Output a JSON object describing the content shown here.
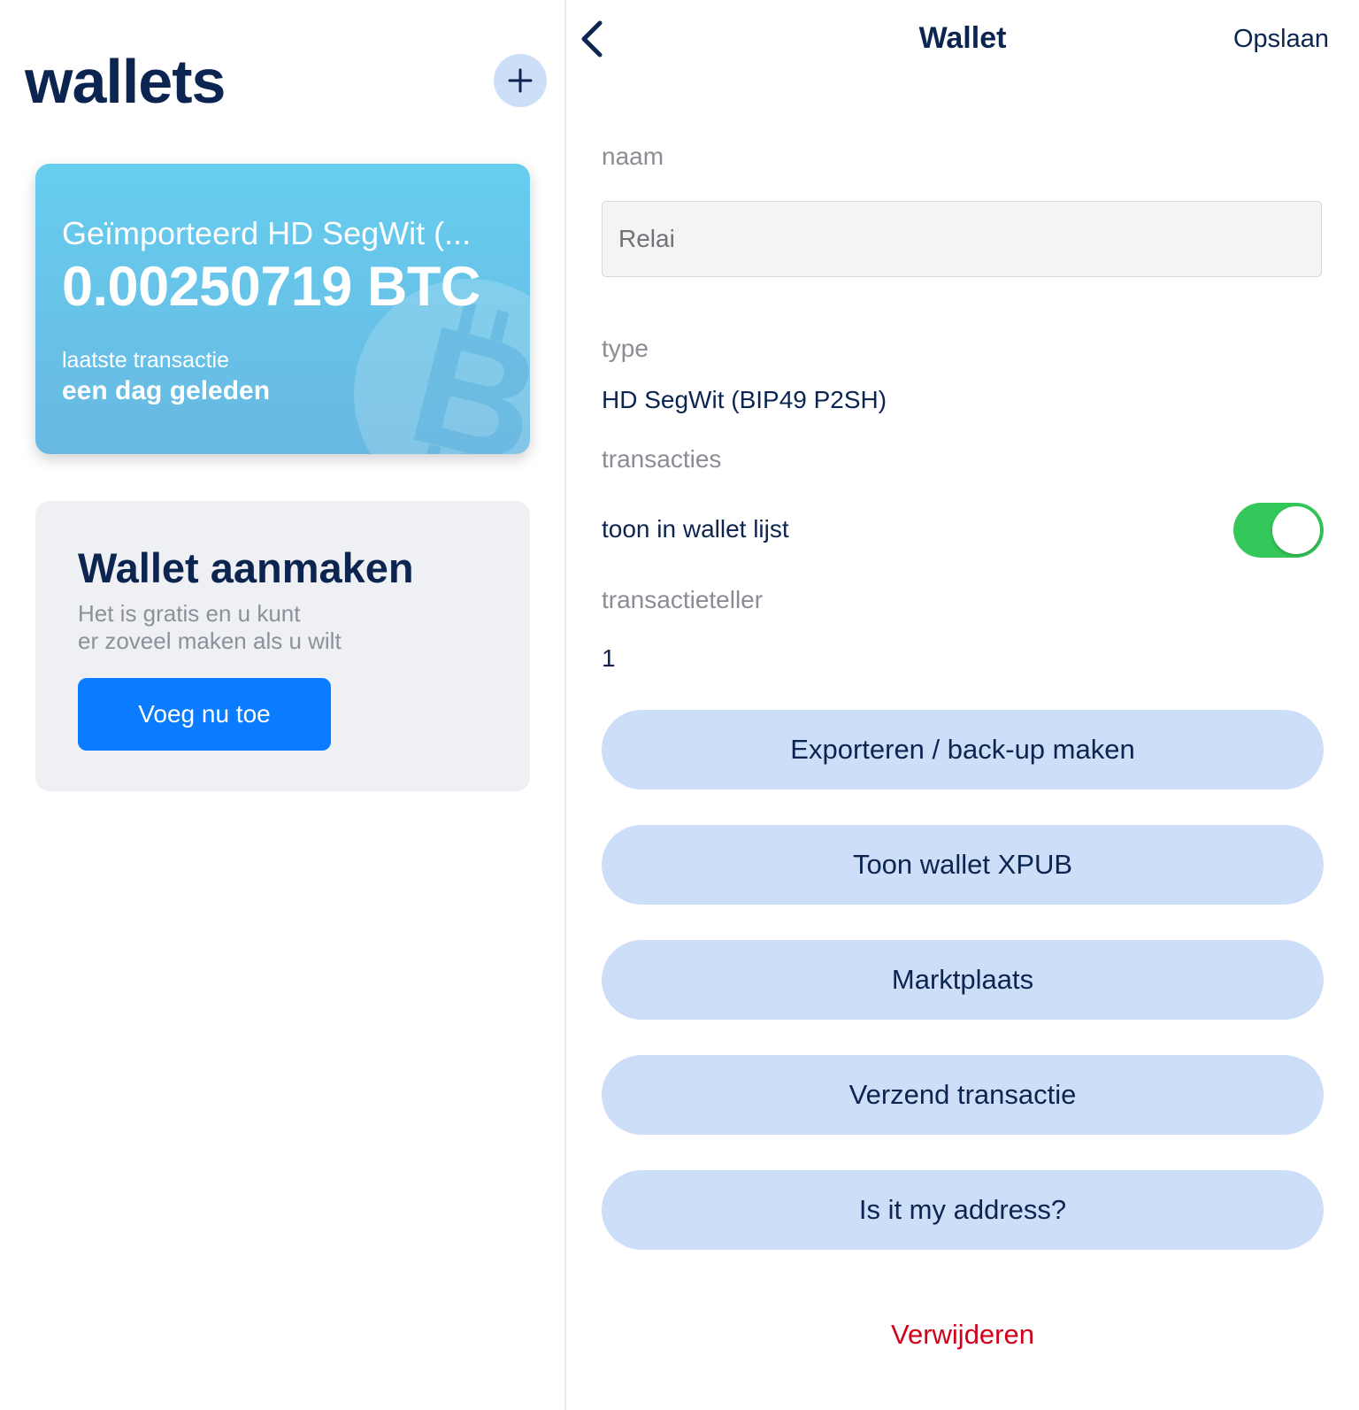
{
  "list": {
    "title": "wallets",
    "add_icon": "plus-icon",
    "wallet_card": {
      "label": "Geïmporteerd HD SegWit (...",
      "balance": "0.00250719 BTC",
      "latest_label": "laatste transactie",
      "latest_value": "een dag geleden",
      "watermark_icon": "bitcoin-icon"
    },
    "create_card": {
      "title": "Wallet aanmaken",
      "subtitle_line1": "Het is gratis en u kunt",
      "subtitle_line2": "er zoveel maken als u wilt",
      "button_label": "Voeg nu toe"
    }
  },
  "detail": {
    "title": "Wallet",
    "save_label": "Opslaan",
    "back_icon": "chevron-left-icon",
    "name_label": "naam",
    "name_value": "Relai",
    "type_label": "type",
    "type_value": "HD SegWit (BIP49 P2SH)",
    "transactions_label": "transacties",
    "show_in_list_label": "toon in wallet lijst",
    "show_in_list_enabled": true,
    "tx_counter_label": "transactieteller",
    "tx_counter_value": "1",
    "actions": [
      "Exporteren / back-up maken",
      "Toon wallet XPUB",
      "Marktplaats",
      "Verzend transactie",
      "Is it my address?"
    ],
    "delete_label": "Verwijderen"
  },
  "colors": {
    "navy": "#0c2550",
    "card_blue": "#67cdee",
    "button_light_blue": "#ccdef8",
    "primary_blue": "#0a7cff",
    "toggle_green": "#34c759",
    "delete_red": "#d0021b"
  }
}
